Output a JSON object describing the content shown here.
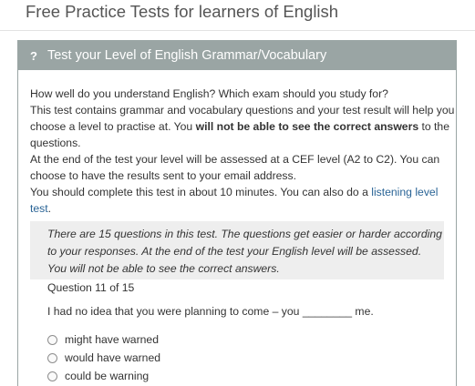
{
  "site": {
    "title": "Free Practice Tests for learners of English"
  },
  "panel": {
    "icon": "question-mark-icon",
    "icon_glyph": "?",
    "heading": "Test your Level of English Grammar/Vocabulary"
  },
  "intro": {
    "line1": "How well do you understand English? Which exam should you study for?",
    "line2": "This test contains grammar and vocabulary questions and your test result will help you",
    "line3_pre": "choose a level to practise at. You ",
    "line3_bold": "will not be able to see the correct answers",
    "line3_post": " to the",
    "line4": "questions.",
    "line5": "At the end of the test your level will be assessed at a CEF level (A2 to C2). You can",
    "line6": "choose to have the results sent to your email address.",
    "line7_pre": "You should complete this test in about 10 minutes. You can also do a ",
    "link_part1": "listening level",
    "link_part2": "test",
    "line8_post": "."
  },
  "notice": {
    "line1": "There are 15 questions in this test. The questions get easier or harder according",
    "line2": "to your responses. At the end of the test your English level will be assessed.",
    "line3": "You will not be able to see the correct answers."
  },
  "question": {
    "number_label": "Question 11 of 15",
    "text": "I had no idea that you were planning to come – you ________ me.",
    "options": [
      "might have warned",
      "would have warned",
      "could be warning"
    ],
    "selected": null
  }
}
